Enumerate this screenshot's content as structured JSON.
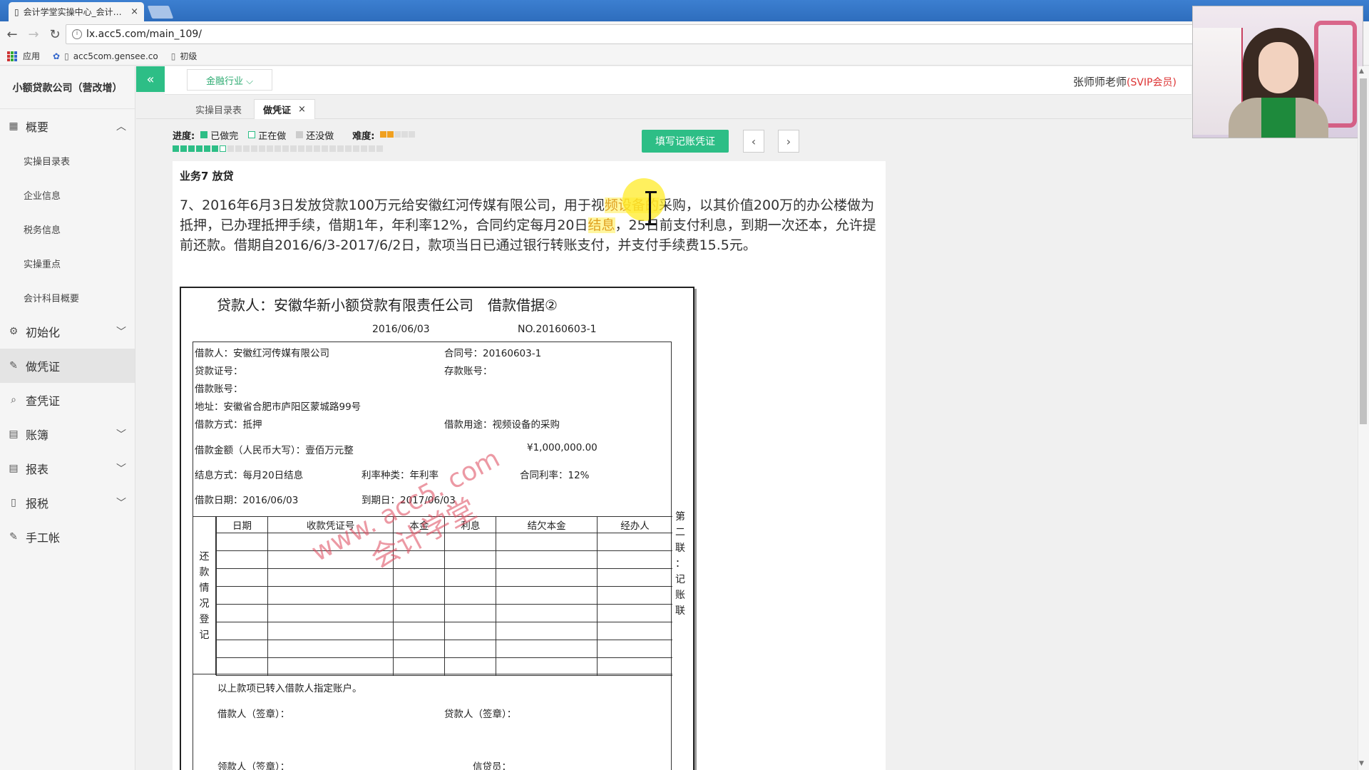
{
  "browser": {
    "tab_title": "会计学堂实操中心_会计…",
    "tab_close": "×",
    "url": "lx.acc5.com/main_109/",
    "bookmarks": [
      {
        "label": "应用"
      },
      {
        "label": "acc5com.gensee.co"
      },
      {
        "label": "初级"
      }
    ]
  },
  "sidebar": {
    "company": "小额贷款公司（营改增）",
    "menu": {
      "overview": "概要",
      "overview_subs": [
        "实操目录表",
        "企业信息",
        "税务信息",
        "实操重点",
        "会计科目概要"
      ],
      "init": "初始化",
      "make_voucher": "做凭证",
      "query_voucher": "查凭证",
      "ledger": "账簿",
      "reports": "报表",
      "tax": "报税",
      "manual": "手工帐"
    }
  },
  "header": {
    "collapse_symbol": "«",
    "industry": "金融行业 ⌵",
    "teacher_name": "张师师老师",
    "teacher_badge": "(SVIP会员)"
  },
  "tabs": [
    {
      "label": "实操目录表"
    },
    {
      "label": "做凭证",
      "close": "×"
    }
  ],
  "progress": {
    "label": "进度:",
    "done": "已做完",
    "doing": "正在做",
    "todo": "还没做",
    "difficulty_label": "难度:",
    "difficulty_stars": 2,
    "difficulty_max": 5,
    "done_count": 6,
    "doing_count": 1,
    "total_count": 27
  },
  "actions": {
    "fill_voucher": "填写记账凭证",
    "prev": "‹",
    "next": "›"
  },
  "task": {
    "title": "业务7 放贷",
    "desc_part1": "7、2016年6月3日发放贷款100万元给安徽红河传媒有限公司，用于视",
    "desc_hl1": "频设备的",
    "desc_part2": "采购，以其价值200万的办公楼做为抵押，已办理抵押手续，借期1年，年利率12%，合同约定每月20日",
    "desc_hl2": "结息",
    "desc_part3": "，25日前支付利息，到期一次还本，允许提前还款。借期自2016/6/3-2017/6/2日，款项当日已通过银行转账支付，并支付手续费15.5元。"
  },
  "voucher": {
    "title": "贷款人：安徽华新小额贷款有限责任公司　借款借据②",
    "date": "2016/06/03",
    "no": "NO.20160603-1",
    "borrower": "借款人：安徽红河传媒有限公司",
    "contract_no": "合同号：20160603-1",
    "loan_cert": "贷款证号：",
    "deposit_acct": "存款账号：",
    "loan_acct": "借款账号：",
    "address": "地址：安徽省合肥市庐阳区蒙城路99号",
    "loan_method": "借款方式：抵押",
    "loan_purpose": "借款用途：视频设备的采购",
    "amount_words": "借款金额（人民币大写）：壹佰万元整",
    "amount_num": "¥1,000,000.00",
    "interest_method": "结息方式：每月20日结息",
    "rate_type": "利率种类：年利率",
    "contract_rate": "合同利率：12%",
    "loan_date": "借款日期：2016/06/03",
    "due_date": "到期日：2017/06/03",
    "repay_label": "还款情况登记",
    "columns": [
      "日期",
      "收款凭证号",
      "本金",
      "利息",
      "结欠本金",
      "经办人"
    ],
    "side_label": "第二联：记账联",
    "transferred": "以上款项已转入借款人指定账户。",
    "borrower_sign": "借款人（签章）：",
    "lender_sign": "贷款人（签章）：",
    "receiver_sign": "领款人（签章）：",
    "credit_officer": "信贷员：",
    "watermark1": "www. acc5. com",
    "watermark2": "会计学堂"
  }
}
